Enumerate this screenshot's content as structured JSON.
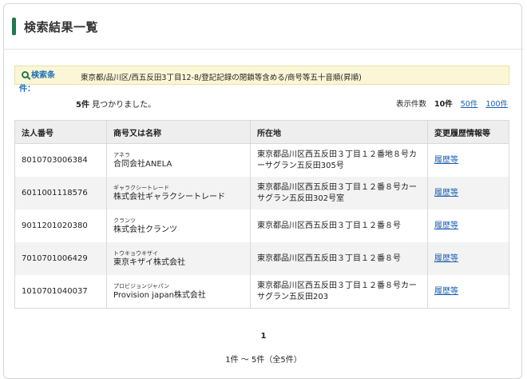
{
  "page": {
    "title": "検索結果一覧"
  },
  "condition": {
    "label_line1": "検索条",
    "label_line2": "件：",
    "text": "東京都/品川区/西五反田3丁目12-8/登記記録の閉鎖等含める/商号等五十音順(昇順)"
  },
  "summary": {
    "count": "5件",
    "count_suffix": " 見つかりました。",
    "per_page_label": "表示件数",
    "per_page_current": "10件",
    "per_page_options": [
      "50件",
      "100件"
    ]
  },
  "table": {
    "headers": [
      "法人番号",
      "商号又は名称",
      "所在地",
      "変更履歴情報等"
    ],
    "rows": [
      {
        "number": "8010703006384",
        "kana": "アネラ",
        "name": "合同会社ANELA",
        "address": "東京都品川区西五反田３丁目１２番地８号カーサグラン五反田305号",
        "history": "履歴等"
      },
      {
        "number": "6011001118576",
        "kana": "ギャラクシートレード",
        "name": "株式会社ギャラクシートレード",
        "address": "東京都品川区西五反田３丁目１２番８号カーサグラン五反田302号室",
        "history": "履歴等"
      },
      {
        "number": "9011201020380",
        "kana": "クランツ",
        "name": "株式会社クランツ",
        "address": "東京都品川区西五反田３丁目１２番８号",
        "history": "履歴等"
      },
      {
        "number": "7010701006429",
        "kana": "トウキョウキザイ",
        "name": "東京キザイ株式会社",
        "address": "東京都品川区西五反田３丁目１２番８号",
        "history": "履歴等"
      },
      {
        "number": "1010701040037",
        "kana": "プロビジョンジャパン",
        "name": "Provision japan株式会社",
        "address": "東京都品川区西五反田３丁目１２番８号カーサグラン五反田203",
        "history": "履歴等"
      }
    ]
  },
  "pagination": {
    "current_page": "1",
    "range": "1件 ～ 5件（全5件）"
  },
  "colors": {
    "accent": "#1f7a4c",
    "link": "#1a5fb4",
    "condition_bg": "#fbf7d6"
  },
  "icons": {
    "condition": "search-icon"
  }
}
